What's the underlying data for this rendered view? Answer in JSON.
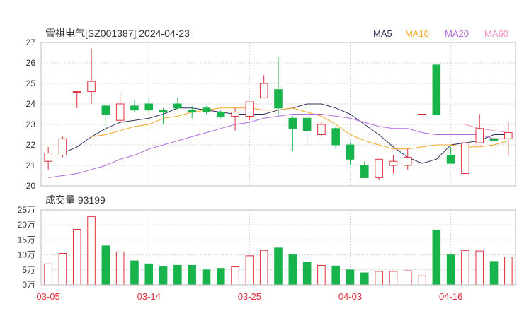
{
  "title": "雪祺电气[SZ001387] 2024-04-23",
  "volume_title": "成交量 93199",
  "legend": [
    {
      "label": "MA5",
      "color": "#2e2e5e"
    },
    {
      "label": "MA10",
      "color": "#f5a623"
    },
    {
      "label": "MA20",
      "color": "#b36bdb"
    },
    {
      "label": "MA60",
      "color": "#f28fc7"
    }
  ],
  "colors": {
    "up": "#e0313b",
    "down": "#17b34b"
  },
  "chart_data": [
    {
      "type": "candlestick",
      "ylim": [
        20,
        27
      ],
      "yticks": [
        20,
        21,
        22,
        23,
        24,
        25,
        26,
        27
      ],
      "x_tick_labels": [
        {
          "index": 0,
          "label": "03-05"
        },
        {
          "index": 7,
          "label": "03-14"
        },
        {
          "index": 14,
          "label": "03-25"
        },
        {
          "index": 21,
          "label": "04-03"
        },
        {
          "index": 28,
          "label": "04-16"
        }
      ],
      "candles": [
        {
          "open": 21.2,
          "close": 21.6,
          "high": 21.9,
          "low": 20.8
        },
        {
          "open": 21.5,
          "close": 22.3,
          "high": 22.4,
          "low": 21.4
        },
        {
          "open": 24.6,
          "close": 24.6,
          "high": 24.6,
          "low": 23.8
        },
        {
          "open": 24.6,
          "close": 25.1,
          "high": 26.7,
          "low": 24.0
        },
        {
          "open": 23.9,
          "close": 23.5,
          "high": 24.0,
          "low": 22.7
        },
        {
          "open": 23.2,
          "close": 24.0,
          "high": 24.5,
          "low": 23.1
        },
        {
          "open": 23.9,
          "close": 23.7,
          "high": 24.2,
          "low": 23.6
        },
        {
          "open": 24.0,
          "close": 23.7,
          "high": 24.3,
          "low": 23.5
        },
        {
          "open": 23.7,
          "close": 23.6,
          "high": 23.8,
          "low": 23.0
        },
        {
          "open": 24.0,
          "close": 23.8,
          "high": 24.3,
          "low": 23.7
        },
        {
          "open": 23.7,
          "close": 23.6,
          "high": 23.9,
          "low": 23.3
        },
        {
          "open": 23.8,
          "close": 23.6,
          "high": 23.9,
          "low": 23.5
        },
        {
          "open": 23.6,
          "close": 23.4,
          "high": 23.7,
          "low": 23.3
        },
        {
          "open": 23.4,
          "close": 23.6,
          "high": 23.8,
          "low": 22.7
        },
        {
          "open": 23.4,
          "close": 24.1,
          "high": 24.1,
          "low": 23.2
        },
        {
          "open": 24.3,
          "close": 25.0,
          "high": 25.4,
          "low": 24.3
        },
        {
          "open": 24.7,
          "close": 23.8,
          "high": 26.3,
          "low": 23.4
        },
        {
          "open": 23.3,
          "close": 22.8,
          "high": 23.4,
          "low": 21.7
        },
        {
          "open": 23.3,
          "close": 22.7,
          "high": 23.4,
          "low": 21.9
        },
        {
          "open": 22.5,
          "close": 23.0,
          "high": 23.1,
          "low": 22.4
        },
        {
          "open": 22.8,
          "close": 22.0,
          "high": 22.9,
          "low": 21.8
        },
        {
          "open": 22.0,
          "close": 21.3,
          "high": 22.1,
          "low": 21.0
        },
        {
          "open": 21.0,
          "close": 20.4,
          "high": 21.2,
          "low": 20.4
        },
        {
          "open": 20.4,
          "close": 21.3,
          "high": 21.3,
          "low": 20.3
        },
        {
          "open": 21.0,
          "close": 21.2,
          "high": 21.5,
          "low": 20.6
        },
        {
          "open": 21.0,
          "close": 21.4,
          "high": 21.8,
          "low": 20.8
        },
        {
          "open": 23.5,
          "close": 23.5,
          "high": 23.5,
          "low": 23.5
        },
        {
          "open": 25.9,
          "close": 23.5,
          "high": 25.9,
          "low": 23.5
        },
        {
          "open": 21.5,
          "close": 21.1,
          "high": 21.9,
          "low": 21.1
        },
        {
          "open": 20.6,
          "close": 22.1,
          "high": 22.1,
          "low": 20.6
        },
        {
          "open": 22.1,
          "close": 22.8,
          "high": 23.5,
          "low": 22.1
        },
        {
          "open": 22.3,
          "close": 22.2,
          "high": 23.0,
          "low": 21.8
        },
        {
          "open": 22.3,
          "close": 22.6,
          "high": 23.1,
          "low": 21.5
        }
      ],
      "ma_series": [
        {
          "name": "MA5",
          "start": 1,
          "values": [
            21.6,
            21.9,
            22.4,
            22.8,
            23.1,
            23.2,
            23.3,
            23.5,
            23.8,
            23.8,
            23.7,
            23.6,
            23.5,
            23.5,
            23.5,
            23.7,
            23.8,
            24.0,
            24.0,
            23.8,
            23.5,
            23.0,
            22.5,
            21.9,
            21.4,
            21.1,
            21.3,
            22.0,
            22.1,
            22.2,
            22.5,
            22.5
          ]
        },
        {
          "name": "MA10",
          "start": 3,
          "values": [
            22.4,
            22.5,
            22.7,
            22.9,
            23.0,
            23.3,
            23.4,
            23.6,
            23.7,
            23.8,
            23.8,
            23.8,
            23.7,
            23.7,
            23.8,
            23.6,
            23.4,
            23.0,
            22.5,
            22.2,
            22.0,
            21.8,
            21.8,
            21.9,
            22.0,
            22.0,
            21.9,
            21.9,
            22.0,
            22.2
          ]
        },
        {
          "name": "MA20",
          "start": 0,
          "values": [
            20.4,
            20.5,
            20.6,
            20.8,
            21.0,
            21.3,
            21.5,
            21.8,
            22.0,
            22.2,
            22.4,
            22.6,
            22.8,
            23.0,
            23.1,
            23.3,
            23.4,
            23.5,
            23.5,
            23.5,
            23.4,
            23.3,
            23.1,
            22.9,
            22.8,
            22.8,
            22.6,
            22.5,
            22.5,
            22.5,
            22.5,
            22.3,
            22.3
          ]
        },
        {
          "name": "MA60",
          "start": 29,
          "values": [
            23.0,
            22.8,
            22.7,
            22.6
          ]
        }
      ]
    },
    {
      "type": "bar",
      "ylim": [
        0,
        25
      ],
      "yticks": [
        {
          "value": 0,
          "label": "0万"
        },
        {
          "value": 5,
          "label": "5万"
        },
        {
          "value": 10,
          "label": "10万"
        },
        {
          "value": 15,
          "label": "15万"
        },
        {
          "value": 20,
          "label": "20万"
        },
        {
          "value": 25,
          "label": "25万"
        }
      ],
      "values": [
        7,
        10.5,
        18.5,
        22.8,
        13,
        11,
        8,
        7,
        6,
        6.5,
        6.5,
        5,
        5.5,
        6,
        9.7,
        11.5,
        12.3,
        10,
        7.5,
        6.5,
        6.3,
        5,
        4,
        4.5,
        4.5,
        4.7,
        3,
        18.3,
        10,
        11.5,
        11.3,
        7.8,
        9.3
      ],
      "up": [
        true,
        true,
        true,
        true,
        false,
        true,
        false,
        false,
        false,
        false,
        false,
        false,
        false,
        true,
        true,
        true,
        false,
        false,
        false,
        true,
        false,
        false,
        false,
        true,
        true,
        true,
        true,
        false,
        false,
        true,
        true,
        false,
        true
      ]
    }
  ]
}
